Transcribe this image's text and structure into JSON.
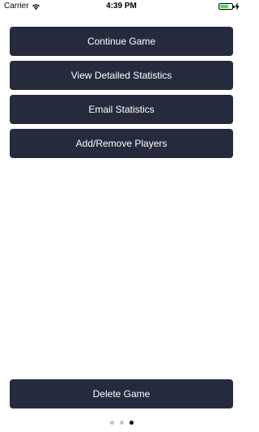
{
  "status_bar": {
    "carrier": "Carrier",
    "time": "4:39 PM",
    "icons": [
      "wifi-icon",
      "battery-icon",
      "charging-icon"
    ],
    "battery_level": 0.65,
    "battery_color": "#4cd964"
  },
  "menu": {
    "continue_label": "Continue Game",
    "stats_label": "View Detailed Statistics",
    "email_label": "Email Statistics",
    "players_label": "Add/Remove Players"
  },
  "delete_label": "Delete Game",
  "page_control": {
    "pages": 3,
    "current_page": 3
  },
  "colors": {
    "button_bg": "#262a3d",
    "button_text": "#ffffff",
    "dot_inactive": "#c4c4c4",
    "dot_active": "#000000"
  }
}
